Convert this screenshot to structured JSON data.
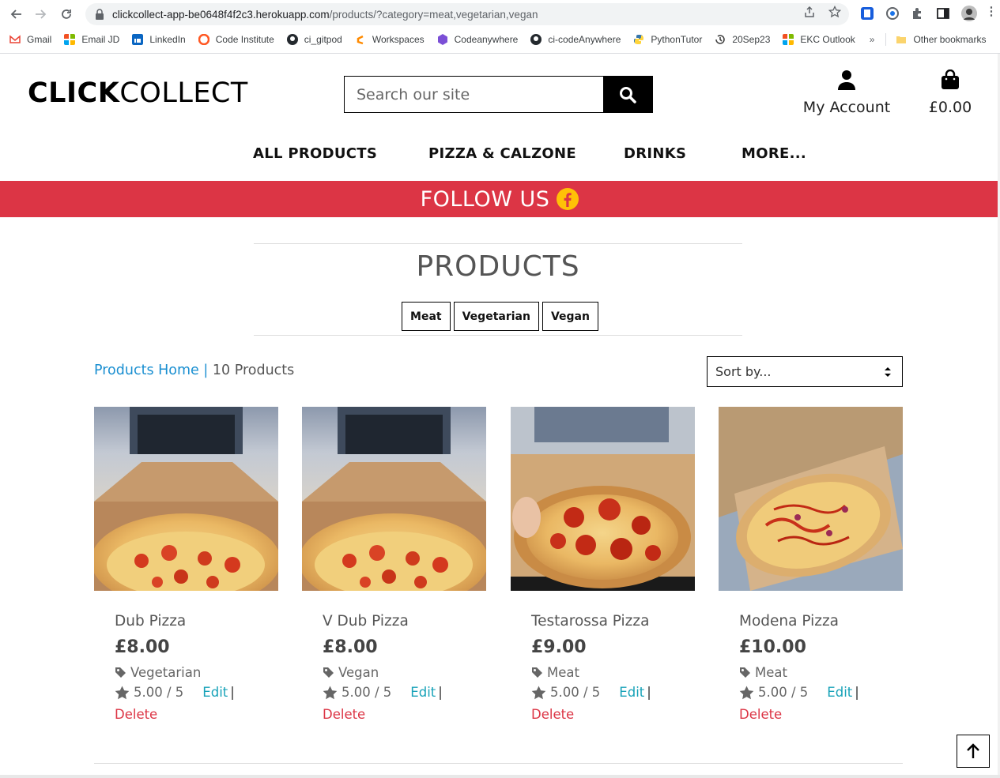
{
  "browser": {
    "url_host": "clickcollect-app-be0648f4f2c3.herokuapp.com",
    "url_path": "/products/?category=meat,vegetarian,vegan",
    "bookmarks": [
      {
        "label": "Gmail",
        "color": "#ea4335"
      },
      {
        "label": "Email JD",
        "color": "#f25022"
      },
      {
        "label": "LinkedIn",
        "color": "#0a66c2"
      },
      {
        "label": "Code Institute",
        "color": "#ff5722"
      },
      {
        "label": "ci_gitpod",
        "color": "#24292e"
      },
      {
        "label": "Workspaces",
        "color": "#ff8a00"
      },
      {
        "label": "Codeanywhere",
        "color": "#7b4fd6"
      },
      {
        "label": "ci-codeAnywhere",
        "color": "#24292e"
      },
      {
        "label": "PythonTutor",
        "color": "#3776ab"
      },
      {
        "label": "20Sep23",
        "color": "#444444"
      },
      {
        "label": "EKC Outlook",
        "color": "#f25022"
      }
    ],
    "overflow": "»",
    "other_bookmarks": "Other bookmarks"
  },
  "header": {
    "logo_bold": "CLICK",
    "logo_light": "COLLECT",
    "search_placeholder": "Search our site",
    "account_label": "My Account",
    "bag_total": "£0.00"
  },
  "nav": {
    "items": [
      "ALL PRODUCTS",
      "PIZZA & CALZONE",
      "DRINKS",
      "MORE..."
    ]
  },
  "banner": {
    "text": "FOLLOW US",
    "color": "#dc3545"
  },
  "products_page": {
    "title": "PRODUCTS",
    "categories": [
      "Meat",
      "Vegetarian",
      "Vegan"
    ],
    "home_link": "Products Home",
    "separator": "|",
    "count": "10 Products",
    "sort_label": "Sort by..."
  },
  "products": [
    {
      "name": "Dub Pizza",
      "price": "£8.00",
      "category": "Vegetarian",
      "rating": "5.00 / 5",
      "edit": "Edit",
      "delete": "Delete",
      "pipe": "|",
      "image": "pizza-margherita"
    },
    {
      "name": "V Dub Pizza",
      "price": "£8.00",
      "category": "Vegan",
      "rating": "5.00 / 5",
      "edit": "Edit",
      "delete": "Delete",
      "pipe": "|",
      "image": "pizza-margherita"
    },
    {
      "name": "Testarossa Pizza",
      "price": "£9.00",
      "category": "Meat",
      "rating": "5.00 / 5",
      "edit": "Edit",
      "delete": "Delete",
      "pipe": "|",
      "image": "pizza-pepperoni"
    },
    {
      "name": "Modena Pizza",
      "price": "£10.00",
      "category": "Meat",
      "rating": "5.00 / 5",
      "edit": "Edit",
      "delete": "Delete",
      "pipe": "|",
      "image": "pizza-modena"
    }
  ],
  "colors": {
    "link_blue": "#1a8fd1",
    "edit_teal": "#17a2b8",
    "delete_red": "#dc3545"
  }
}
